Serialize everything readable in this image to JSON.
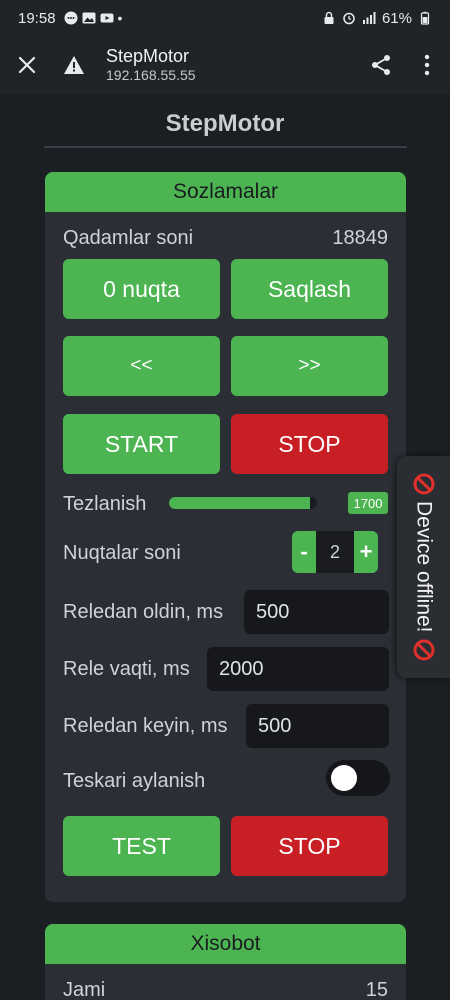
{
  "statusbar": {
    "time": "19:58",
    "battery": "61%",
    "notif_dot": "•"
  },
  "toolbar": {
    "title": "StepMotor",
    "url": "192.168.55.55"
  },
  "page": {
    "title": "StepMotor"
  },
  "settings": {
    "header": "Sozlamalar",
    "steps_label": "Qadamlar soni",
    "steps_value": "18849",
    "btn_zero": "0 nuqta",
    "btn_save": "Saqlash",
    "btn_back": "<<",
    "btn_fwd": ">>",
    "btn_start": "START",
    "btn_stop": "STOP",
    "accel_label": "Tezlanish",
    "accel_value": "1700",
    "accel_fraction": 0.95,
    "points_label": "Nuqtalar soni",
    "points_minus": "-",
    "points_value": "2",
    "points_plus": "+",
    "before_relay_label": "Reledan oldin, ms",
    "before_relay_value": "500",
    "relay_time_label": "Rele vaqti, ms",
    "relay_time_value": "2000",
    "after_relay_label": "Reledan keyin, ms",
    "after_relay_value": "500",
    "reverse_label": "Teskari aylanish",
    "reverse_on": false,
    "btn_test": "TEST",
    "btn_stop2": "STOP"
  },
  "report": {
    "header": "Xisobot",
    "total_label": "Jami",
    "total_value": "15"
  },
  "offline": {
    "text": "Device offline!"
  },
  "colors": {
    "green": "#4cb552",
    "red": "#c81f24",
    "card": "#2b2e35",
    "bg": "#1b1e22"
  }
}
